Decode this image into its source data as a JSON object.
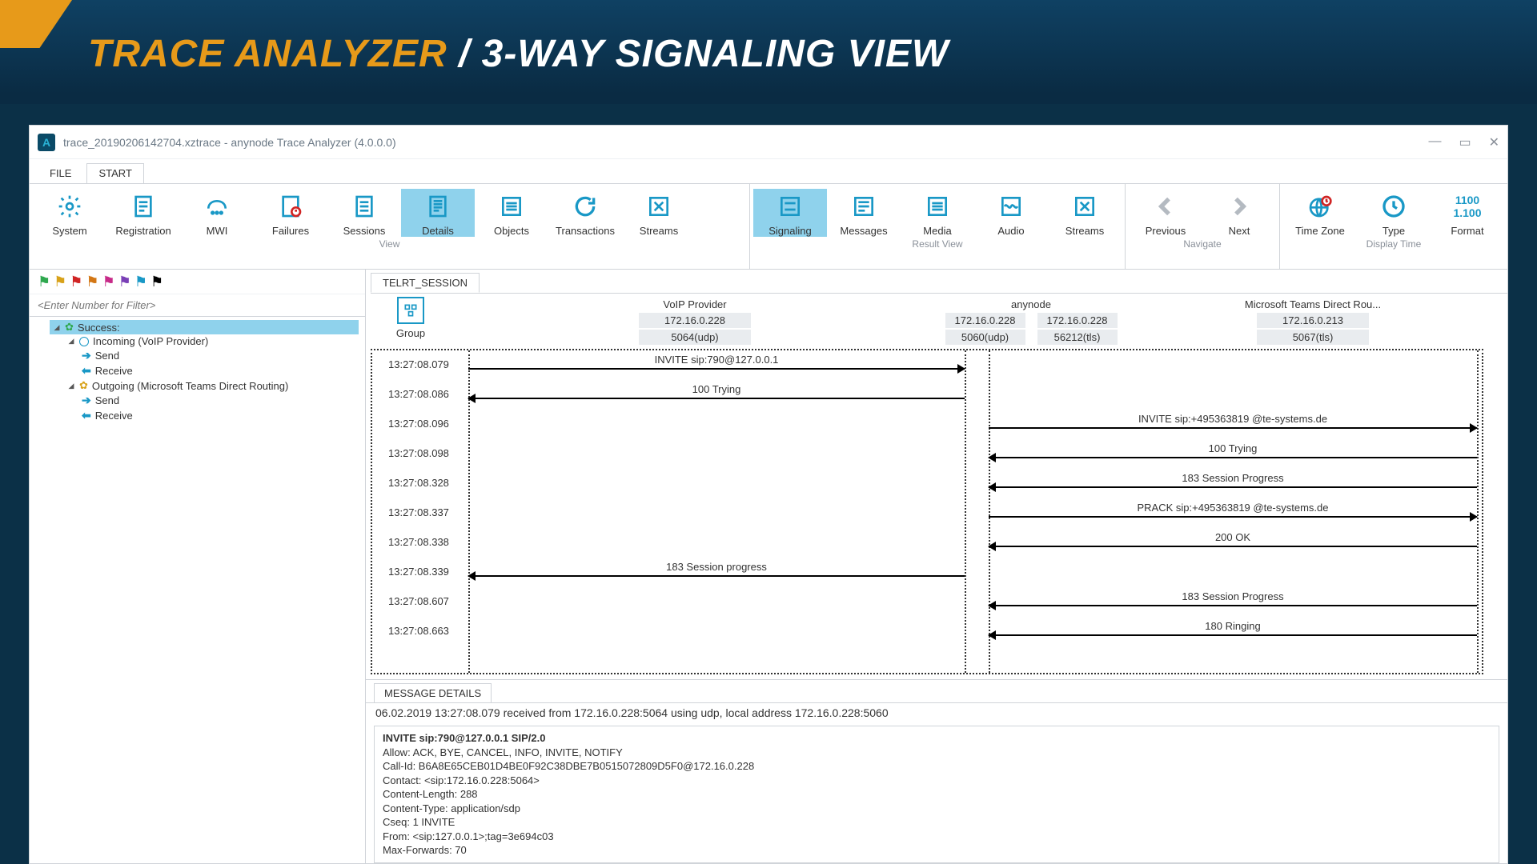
{
  "slide": {
    "title_prefix": "TRACE ANALYZER",
    "title_sep": " / ",
    "title_suffix": "3-WAY SIGNALING VIEW"
  },
  "window": {
    "title": "trace_20190206142704.xztrace - anynode Trace Analyzer (4.0.0.0)",
    "menus": {
      "file": "FILE",
      "start": "START"
    }
  },
  "ribbon": {
    "groups": {
      "view": {
        "caption": "View",
        "items": {
          "system": "System",
          "registration": "Registration",
          "mwi": "MWI",
          "failures": "Failures",
          "sessions": "Sessions",
          "details": "Details",
          "objects": "Objects",
          "transactions": "Transactions",
          "streams": "Streams"
        }
      },
      "result": {
        "caption": "Result View",
        "items": {
          "signaling": "Signaling",
          "messages": "Messages",
          "media": "Media",
          "audio": "Audio",
          "streams": "Streams"
        }
      },
      "navigate": {
        "caption": "Navigate",
        "items": {
          "previous": "Previous",
          "next": "Next"
        }
      },
      "display": {
        "caption": "Display Time",
        "items": {
          "timezone": "Time Zone",
          "type": "Type",
          "format": "Format",
          "format_top": "1100",
          "format_bottom": "1.100"
        }
      }
    }
  },
  "sidebar": {
    "flags": [
      "#2fa84f",
      "#d8a21a",
      "#d02424",
      "#d37715",
      "#c72a88",
      "#7a3fb6",
      "#1998c6",
      "#000"
    ],
    "filter_placeholder": "<Enter Number for Filter>",
    "tree": {
      "success": "Success:",
      "incoming": "Incoming (VoIP Provider)",
      "send": "Send",
      "receive": "Receive",
      "outgoing": "Outgoing (Microsoft Teams Direct Routing)"
    }
  },
  "signaling": {
    "tab": "TELRT_SESSION",
    "group_label": "Group",
    "columns": {
      "voip": {
        "title": "VoIP Provider",
        "ip": "172.16.0.228",
        "port": "5064(udp)"
      },
      "anynode": {
        "title": "anynode",
        "ip1": "172.16.0.228",
        "port1": "5060(udp)",
        "ip2": "172.16.0.228",
        "port2": "56212(tls)"
      },
      "teams": {
        "title": "Microsoft Teams Direct Rou...",
        "ip": "172.16.0.213",
        "port": "5067(tls)"
      }
    },
    "rows": [
      {
        "time": "13:27:08.079",
        "label": "INVITE sip:790@127.0.0.1",
        "seg": "left",
        "dir": "r"
      },
      {
        "time": "13:27:08.086",
        "label": "100 Trying",
        "seg": "left",
        "dir": "l"
      },
      {
        "time": "13:27:08.096",
        "label": "INVITE sip:+495363819        @te-systems.de",
        "seg": "right",
        "dir": "r"
      },
      {
        "time": "13:27:08.098",
        "label": "100 Trying",
        "seg": "right",
        "dir": "l"
      },
      {
        "time": "13:27:08.328",
        "label": "183 Session Progress",
        "seg": "right",
        "dir": "l"
      },
      {
        "time": "13:27:08.337",
        "label": "PRACK sip:+495363819        @te-systems.de",
        "seg": "right",
        "dir": "r"
      },
      {
        "time": "13:27:08.338",
        "label": "200 OK",
        "seg": "right",
        "dir": "l"
      },
      {
        "time": "13:27:08.339",
        "label": "183 Session progress",
        "seg": "left",
        "dir": "l"
      },
      {
        "time": "13:27:08.607",
        "label": "183 Session Progress",
        "seg": "right",
        "dir": "l"
      },
      {
        "time": "13:27:08.663",
        "label": "180 Ringing",
        "seg": "right",
        "dir": "l"
      }
    ]
  },
  "message_details": {
    "tab": "MESSAGE DETAILS",
    "summary": "06.02.2019 13:27:08.079 received from 172.16.0.228:5064 using udp, local address 172.16.0.228:5060",
    "bold_line": "INVITE sip:790@127.0.0.1 SIP/2.0",
    "line_allow": "Allow: ACK, BYE, CANCEL, INFO, INVITE, NOTIFY",
    "line_callid": "Call-Id: B6A8E65CEB01D4BE0F92C38DBE7B0515072809D5F0@172.16.0.228",
    "line_contact": "Contact: <sip:172.16.0.228:5064>",
    "line_clen": "Content-Length: 288",
    "line_ctype": "Content-Type: application/sdp",
    "line_cseq": "Cseq: 1 INVITE",
    "line_from": "From: <sip:127.0.0.1>;tag=3e694c03",
    "line_maxfwd": "Max-Forwards: 70"
  }
}
